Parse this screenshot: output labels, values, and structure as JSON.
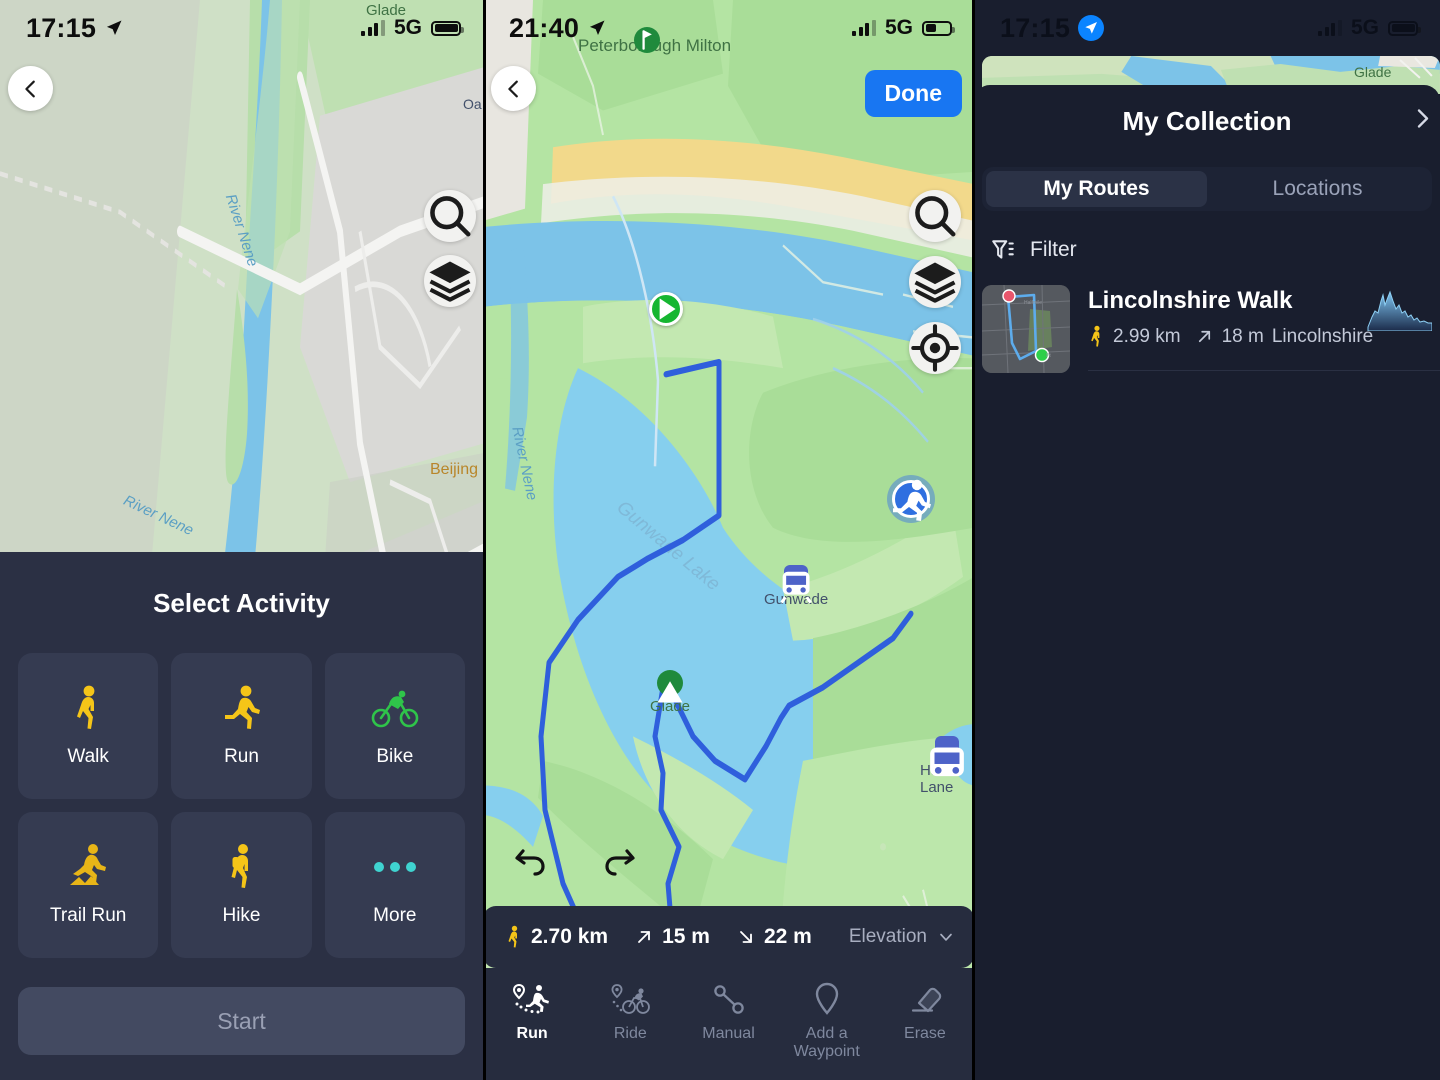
{
  "panel_select": {
    "status": {
      "time": "17:15",
      "network": "5G",
      "location_icon": "location-arrow-icon"
    },
    "back_label": "back-chevron",
    "map_labels": {
      "glade": "Glade",
      "oa": "Oa",
      "river_1": "River Nene",
      "river_2": "River Nene",
      "beijing": "Beijing"
    },
    "controls": {
      "search": "search-icon",
      "layers": "layers-icon"
    },
    "sheet": {
      "title": "Select Activity",
      "activities": [
        {
          "label": "Walk",
          "icon": "walk-icon",
          "color": "#f5c518"
        },
        {
          "label": "Run",
          "icon": "run-icon",
          "color": "#f5c518"
        },
        {
          "label": "Bike",
          "icon": "bike-icon",
          "color": "#2fc44a"
        },
        {
          "label": "Trail Run",
          "icon": "trail-run-icon",
          "color": "#e8b517"
        },
        {
          "label": "Hike",
          "icon": "hike-icon",
          "color": "#f5c518"
        },
        {
          "label": "More",
          "icon": "more-dots-icon",
          "color": "#3fd3d0"
        }
      ],
      "start_label": "Start"
    }
  },
  "panel_route": {
    "status": {
      "time": "21:40",
      "network": "5G",
      "location_icon": "location-arrow-icon"
    },
    "done_label": "Done",
    "map_labels": {
      "peterborough": "Peterborough Milton",
      "river": "River Nene",
      "lake": "Gunwade Lake",
      "gunwade": "Gunwade",
      "glade": "Glade",
      "ham_lane": "Ham Lane"
    },
    "controls": {
      "search": "search-icon",
      "layers": "layers-icon",
      "locate": "locate-icon",
      "undo": "undo-icon",
      "redo": "redo-icon"
    },
    "stats": {
      "distance": "2.70 km",
      "ascent": "15 m",
      "descent": "22 m",
      "elevation_label": "Elevation"
    },
    "tools": [
      {
        "label": "Run",
        "icon": "run-route-icon",
        "active": true
      },
      {
        "label": "Ride",
        "icon": "ride-route-icon",
        "active": false
      },
      {
        "label": "Manual",
        "icon": "manual-line-icon",
        "active": false
      },
      {
        "label": "Add a\nWaypoint",
        "label_line1": "Add a",
        "label_line2": "Waypoint",
        "icon": "waypoint-pin-icon",
        "active": false
      },
      {
        "label": "Erase",
        "icon": "eraser-icon",
        "active": false
      }
    ]
  },
  "panel_collection": {
    "status": {
      "time": "17:15",
      "network": "5G",
      "location_icon": "location-arrow-icon"
    },
    "map_label_glade": "Glade",
    "title": "My Collection",
    "chevron": "chevron-right-icon",
    "tabs": [
      {
        "label": "My Routes",
        "active": true
      },
      {
        "label": "Locations",
        "active": false
      }
    ],
    "filter_label": "Filter",
    "routes": [
      {
        "name": "Lincolnshire Walk",
        "distance": "2.99 km",
        "ascent": "18 m",
        "region": "Lincolnshire",
        "activity_icon": "walk-icon"
      }
    ]
  },
  "colors": {
    "sheet_bg": "#2b3044",
    "card_bg": "#353b51",
    "collection_bg": "#191e2e",
    "accent_blue": "#1876f2",
    "route_line": "#2f5fdc",
    "yellow": "#f5c518",
    "green": "#2fc44a"
  }
}
